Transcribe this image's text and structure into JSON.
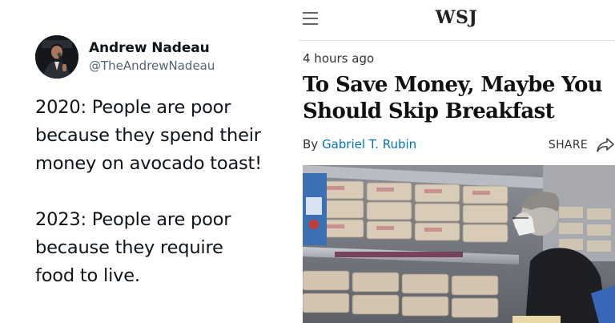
{
  "tweet": {
    "display_name": "Andrew Nadeau",
    "handle": "@TheAndrewNadeau",
    "paragraph_1": [
      "2020: People are poor",
      "because they spend their",
      "money on avocado toast!"
    ],
    "paragraph_2": [
      "2023: People are poor",
      "because they require",
      "food to live."
    ]
  },
  "article": {
    "brand": "WSJ",
    "timestamp": "4 hours ago",
    "headline": [
      "To Save Money, Maybe You",
      "Should Skip Breakfast"
    ],
    "byline_prefix": "By",
    "author": "Gabriel T. Rubin",
    "share_label": "SHARE"
  },
  "icons": {
    "menu": "hamburger-menu-icon",
    "share": "share-arrow-icon"
  },
  "colors": {
    "author_link": "#0274b6",
    "handle_gray": "#536471",
    "text": "#0f1419"
  }
}
